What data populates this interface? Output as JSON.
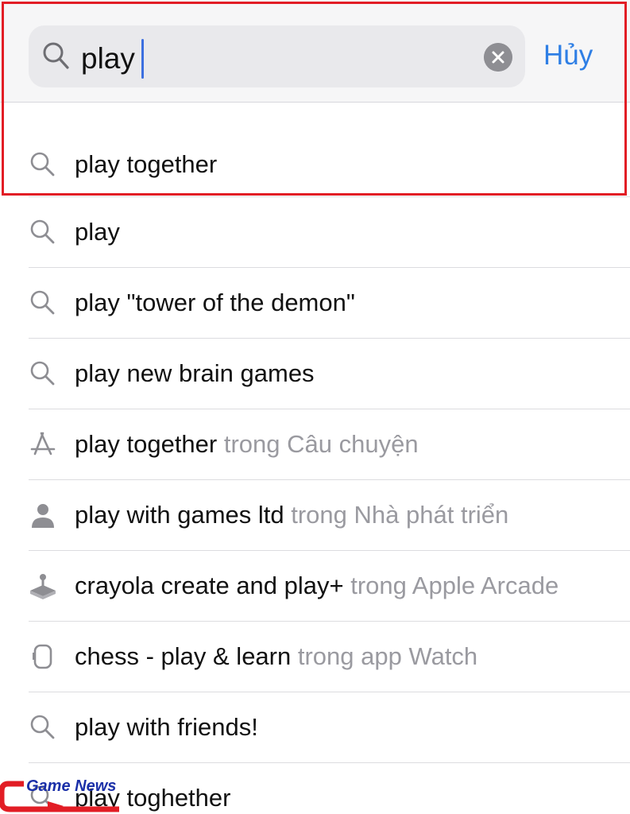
{
  "search": {
    "query": "play",
    "cancel_label": "Hủy"
  },
  "suggestions": [
    {
      "icon": "search-icon",
      "label": "play together",
      "suffix": ""
    },
    {
      "icon": "search-icon",
      "label": "play",
      "suffix": ""
    },
    {
      "icon": "search-icon",
      "label": "play \"tower of the demon\"",
      "suffix": ""
    },
    {
      "icon": "search-icon",
      "label": "play new brain games",
      "suffix": ""
    },
    {
      "icon": "app-store-icon",
      "label": "play together",
      "suffix": "trong Câu chuyện"
    },
    {
      "icon": "person-icon",
      "label": "play with games ltd",
      "suffix": "trong Nhà phát triển"
    },
    {
      "icon": "arcade-joystick-icon",
      "label": "crayola create and play+",
      "suffix": "trong Apple Arcade"
    },
    {
      "icon": "watch-icon",
      "label": "chess - play & learn",
      "suffix": "trong app Watch"
    },
    {
      "icon": "search-icon",
      "label": "play with friends!",
      "suffix": ""
    },
    {
      "icon": "search-icon",
      "label": "play toghether",
      "suffix": ""
    }
  ],
  "watermark": {
    "text": "Game News"
  },
  "colors": {
    "accent": "#2f7fe5",
    "highlight": "#e21d25",
    "caret": "#3c6fe0",
    "secondary_text": "#9a9aa0"
  }
}
